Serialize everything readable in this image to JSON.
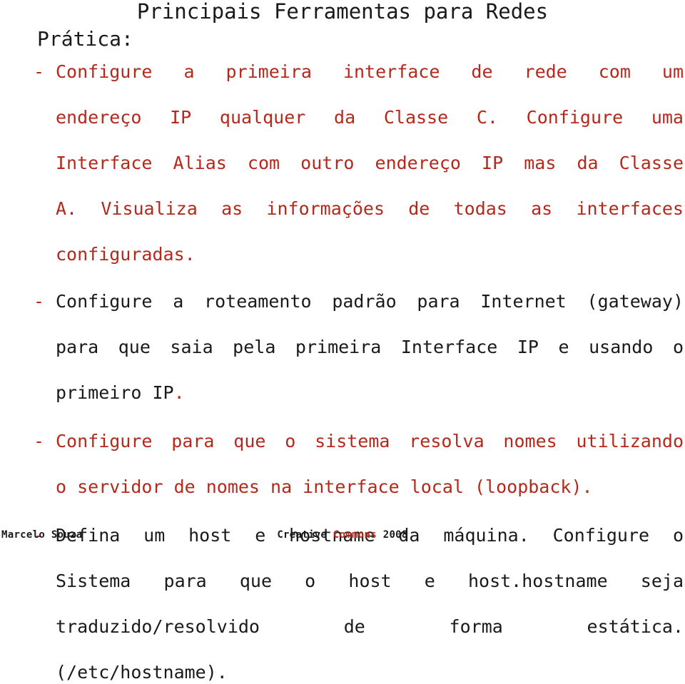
{
  "slide": {
    "title": "Principais Ferramentas para Redes",
    "subtitle": "Prática:",
    "bullet_marker": "-",
    "colors": {
      "accent_red": "#b5291c",
      "text_black": "#1a1a1a",
      "background": "#ffffff"
    },
    "bullets": [
      {
        "color": "red",
        "lines": [
          " Configure a primeira interface de rede com um",
          "endereço IP qualquer da Classe C. Configure uma",
          "Interface Alias com outro endereço IP mas da Classe",
          "A. Visualiza as informações de todas as interfaces",
          "configuradas."
        ],
        "text": "Configure a primeira interface de rede com um endereço IP qualquer da Classe C. Configure uma Interface Alias com outro endereço IP mas da Classe A. Visualiza as informações de todas as interfaces configuradas."
      },
      {
        "color": "black",
        "lines": [
          "Configure a roteamento padrão para Internet (gateway)",
          "para que saia pela primeira Interface IP e usando o",
          "primeiro IP"
        ],
        "trailing_period_red": ".",
        "text": "Configure a roteamento padrão para Internet (gateway) para que saia pela primeira Interface IP e usando o primeiro IP."
      },
      {
        "color": "red",
        "lines": [
          "Configure para que o sistema resolva nomes utilizando",
          "o servidor de nomes na interface local (loopback)."
        ],
        "text": "Configure para que o sistema resolva nomes utilizando o servidor de nomes na interface local (loopback)."
      },
      {
        "color": "black",
        "lines": [
          " Defina um host e hostname da máquina. Configure o",
          "Sistema para que o host e host.hostname seja",
          "traduzido/resolvido de forma estática.",
          "(/etc/hostname)."
        ],
        "text": "Defina um host e hostname da máquina. Configure o Sistema para que o host e host.hostname seja traduzido/resolvido de forma estática. (/etc/hostname)."
      }
    ]
  },
  "footer": {
    "author": "Marcelo Souza",
    "license_prefix": "Creative ",
    "license_highlight": "Commons",
    "license_suffix": " 2008"
  }
}
